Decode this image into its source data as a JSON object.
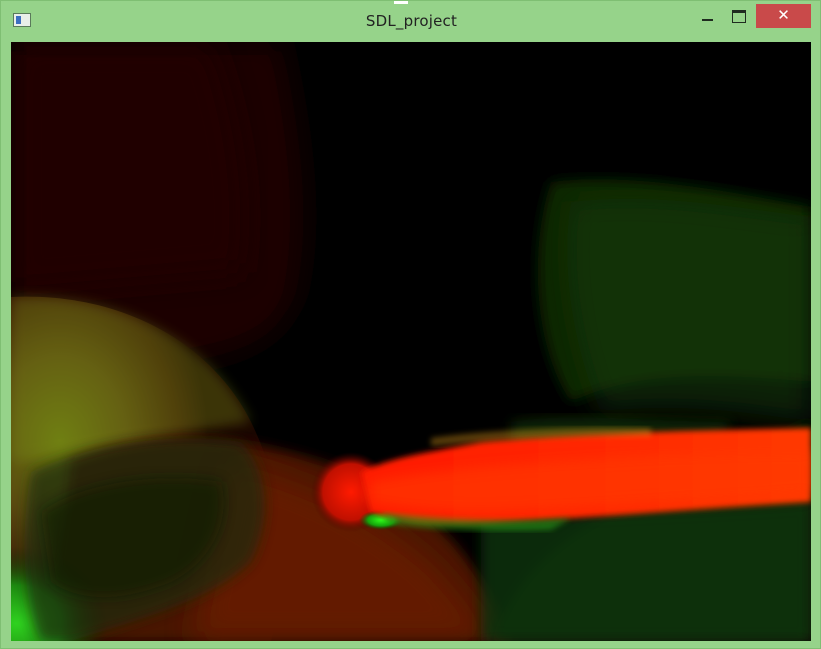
{
  "window": {
    "title": "SDL_project",
    "controls": {
      "minimize_icon": "minimize-icon",
      "maximize_icon": "maximize-icon",
      "close_glyph": "✕"
    },
    "frame_color": "#96d38a",
    "close_color": "#c94a4a"
  },
  "canvas": {
    "description_colors": {
      "background": "#000000",
      "red": "#ff2a00",
      "green": "#1fe01a"
    }
  }
}
